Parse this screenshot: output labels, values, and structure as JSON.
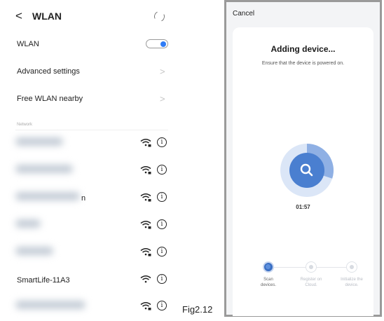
{
  "wlan_screen": {
    "header": {
      "back_glyph": "<",
      "title": "WLAN",
      "refresh_icon": "refresh-icon"
    },
    "wlan_toggle": {
      "label": "WLAN",
      "state": "on",
      "accent": "#2f7cf6"
    },
    "menu": [
      {
        "label": "Advanced settings",
        "chevron": ">"
      },
      {
        "label": "Free WLAN nearby",
        "chevron": ">"
      }
    ],
    "network_section_label": "Network",
    "networks": [
      {
        "name": "",
        "name_tail": "",
        "wifi_icon": "wifi-secured-icon",
        "info_glyph": "i"
      },
      {
        "name": "",
        "name_tail": "",
        "wifi_icon": "wifi-secured-icon",
        "info_glyph": "i"
      },
      {
        "name": "",
        "name_tail": "n",
        "wifi_icon": "wifi-secured-icon",
        "info_glyph": "i"
      },
      {
        "name": "",
        "name_tail": "",
        "wifi_icon": "wifi-secured-icon",
        "info_glyph": "i"
      },
      {
        "name": "",
        "name_tail": "",
        "wifi_icon": "wifi-secured-icon",
        "info_glyph": "i"
      },
      {
        "name": "SmartLife-11A3",
        "name_tail": "",
        "wifi_icon": "wifi-open-icon",
        "info_glyph": "i"
      },
      {
        "name": "",
        "name_tail": "",
        "wifi_icon": "wifi-secured-icon",
        "info_glyph": "i"
      }
    ]
  },
  "caption": "Fig2.12",
  "adding_screen": {
    "cancel_label": "Cancel",
    "title": "Adding device...",
    "subtitle": "Ensure that the device is powered on.",
    "search_icon": "search-icon",
    "progress_fraction": 0.3,
    "timer": "01:57",
    "accent": "#4a7fd0",
    "steps": [
      {
        "label_line1": "Scan",
        "label_line2": "devices.",
        "active": true
      },
      {
        "label_line1": "Register on",
        "label_line2": "Cloud.",
        "active": false
      },
      {
        "label_line1": "Initialize the",
        "label_line2": "device.",
        "active": false
      }
    ]
  }
}
